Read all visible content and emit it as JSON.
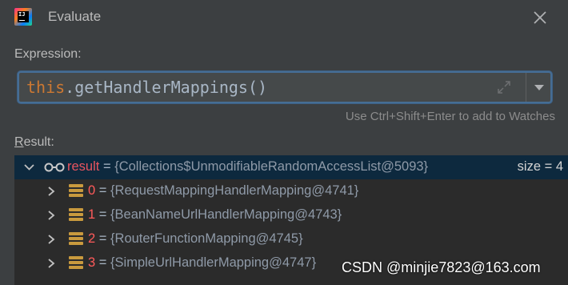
{
  "window": {
    "title": "Evaluate",
    "app_logo_text": "IJ"
  },
  "expression": {
    "label": "Expression:",
    "keyword": "this",
    "rest": ".getHandlerMappings()",
    "hint": "Use Ctrl+Shift+Enter to add to Watches"
  },
  "result": {
    "label_mnemonic": "R",
    "label_rest": "esult:",
    "root": {
      "name": "result",
      "eq": "=",
      "value": "{Collections$UnmodifiableRandomAccessList@5093}",
      "size": "size = 4"
    },
    "items": [
      {
        "index": "0",
        "eq": "=",
        "value": "{RequestMappingHandlerMapping@4741}"
      },
      {
        "index": "1",
        "eq": "=",
        "value": "{BeanNameUrlHandlerMapping@4743}"
      },
      {
        "index": "2",
        "eq": "=",
        "value": "{RouterFunctionMapping@4745}"
      },
      {
        "index": "3",
        "eq": "=",
        "value": "{SimpleUrlHandlerMapping@4747}"
      }
    ]
  },
  "watermark": "CSDN @minjie7823@163.com",
  "colors": {
    "background": "#3c3f41",
    "tree_background": "#2b2b2b",
    "selection": "#0d293e",
    "focus_border": "#466d94",
    "keyword": "#cc7832",
    "index_red": "#ff5a5a",
    "list_icon": "#c99a3e"
  },
  "icons": [
    "intellij-logo-icon",
    "close-icon",
    "expand-icon",
    "dropdown-arrow-icon",
    "chevron-down-icon",
    "chevron-right-icon",
    "watch-glasses-icon",
    "list-element-icon"
  ]
}
